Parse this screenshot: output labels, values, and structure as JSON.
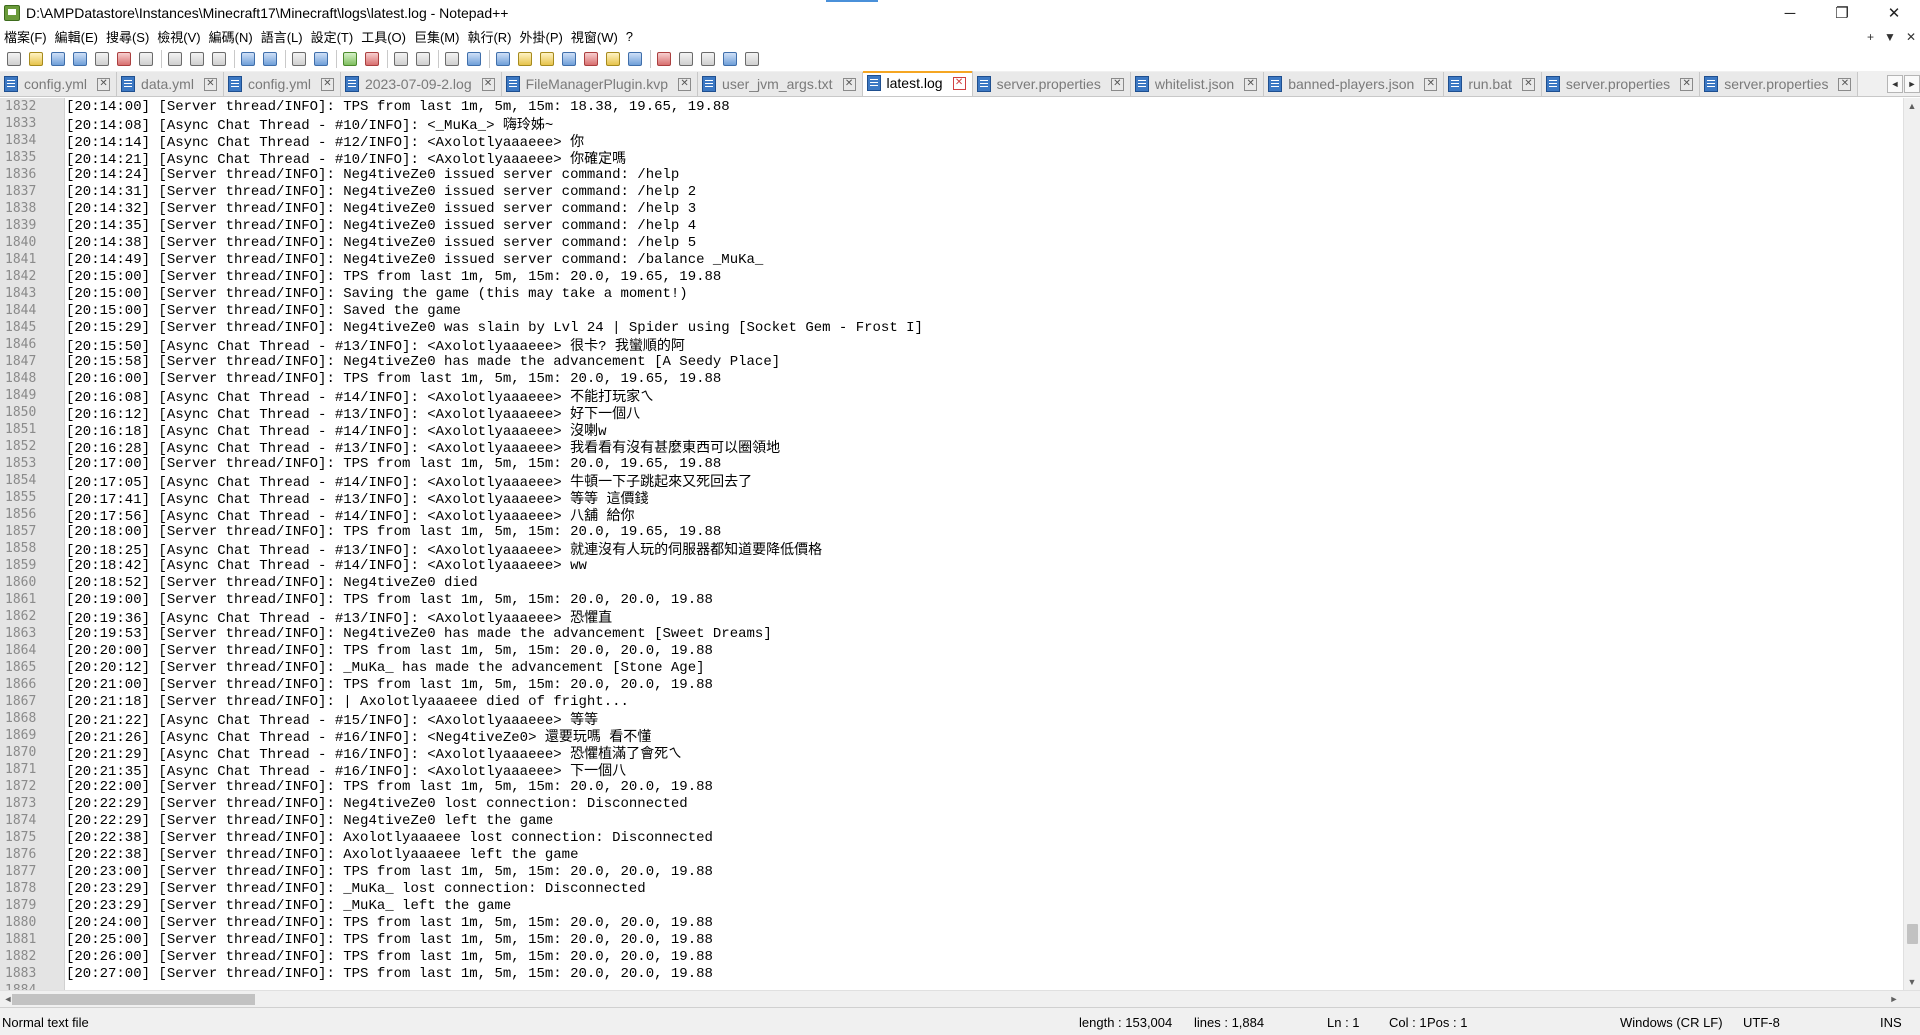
{
  "window": {
    "title": "D:\\AMPDatastore\\Instances\\Minecraft17\\Minecraft\\logs\\latest.log - Notepad++",
    "minimize": "─",
    "maximize": "❐",
    "close": "✕"
  },
  "menu": {
    "items": [
      "檔案(F)",
      "編輯(E)",
      "搜尋(S)",
      "檢視(V)",
      "編碼(N)",
      "語言(L)",
      "設定(T)",
      "工具(O)",
      "巨集(M)",
      "執行(R)",
      "外掛(P)",
      "視窗(W)",
      "?"
    ],
    "right": [
      "+",
      "▼",
      "✕"
    ]
  },
  "tabs": [
    {
      "label": "config.yml"
    },
    {
      "label": "data.yml"
    },
    {
      "label": "config.yml"
    },
    {
      "label": "2023-07-09-2.log"
    },
    {
      "label": "FileManagerPlugin.kvp"
    },
    {
      "label": "user_jvm_args.txt"
    },
    {
      "label": "latest.log",
      "active": true
    },
    {
      "label": "server.properties"
    },
    {
      "label": "whitelist.json"
    },
    {
      "label": "banned-players.json"
    },
    {
      "label": "run.bat"
    },
    {
      "label": "server.properties"
    },
    {
      "label": "server.properties"
    }
  ],
  "tab_nav": {
    "prev": "◄",
    "next": "►"
  },
  "lines": [
    {
      "n": "1832",
      "t": "[20:14:00] [Server thread/INFO]: TPS from last 1m, 5m, 15m: 18.38, 19.65, 19.88"
    },
    {
      "n": "1833",
      "t": "[20:14:08] [Async Chat Thread - #10/INFO]: <_MuKa_> 嗨玲姊~"
    },
    {
      "n": "1834",
      "t": "[20:14:14] [Async Chat Thread - #12/INFO]: <Axolotlyaaaeee> 你"
    },
    {
      "n": "1835",
      "t": "[20:14:21] [Async Chat Thread - #10/INFO]: <Axolotlyaaaeee> 你確定嗎"
    },
    {
      "n": "1836",
      "t": "[20:14:24] [Server thread/INFO]: Neg4tiveZe0 issued server command: /help"
    },
    {
      "n": "1837",
      "t": "[20:14:31] [Server thread/INFO]: Neg4tiveZe0 issued server command: /help 2"
    },
    {
      "n": "1838",
      "t": "[20:14:32] [Server thread/INFO]: Neg4tiveZe0 issued server command: /help 3"
    },
    {
      "n": "1839",
      "t": "[20:14:35] [Server thread/INFO]: Neg4tiveZe0 issued server command: /help 4"
    },
    {
      "n": "1840",
      "t": "[20:14:38] [Server thread/INFO]: Neg4tiveZe0 issued server command: /help 5"
    },
    {
      "n": "1841",
      "t": "[20:14:49] [Server thread/INFO]: Neg4tiveZe0 issued server command: /balance _MuKa_"
    },
    {
      "n": "1842",
      "t": "[20:15:00] [Server thread/INFO]: TPS from last 1m, 5m, 15m: 20.0, 19.65, 19.88"
    },
    {
      "n": "1843",
      "t": "[20:15:00] [Server thread/INFO]: Saving the game (this may take a moment!)"
    },
    {
      "n": "1844",
      "t": "[20:15:00] [Server thread/INFO]: Saved the game"
    },
    {
      "n": "1845",
      "t": "[20:15:29] [Server thread/INFO]: Neg4tiveZe0 was slain by Lvl 24 | Spider using [Socket Gem - Frost I]"
    },
    {
      "n": "1846",
      "t": "[20:15:50] [Async Chat Thread - #13/INFO]: <Axolotlyaaaeee> 很卡? 我蠻順的阿"
    },
    {
      "n": "1847",
      "t": "[20:15:58] [Server thread/INFO]: Neg4tiveZe0 has made the advancement [A Seedy Place]"
    },
    {
      "n": "1848",
      "t": "[20:16:00] [Server thread/INFO]: TPS from last 1m, 5m, 15m: 20.0, 19.65, 19.88"
    },
    {
      "n": "1849",
      "t": "[20:16:08] [Async Chat Thread - #14/INFO]: <Axolotlyaaaeee> 不能打玩家ㄟ"
    },
    {
      "n": "1850",
      "t": "[20:16:12] [Async Chat Thread - #13/INFO]: <Axolotlyaaaeee> 好下一個八"
    },
    {
      "n": "1851",
      "t": "[20:16:18] [Async Chat Thread - #14/INFO]: <Axolotlyaaaeee> 沒喇w"
    },
    {
      "n": "1852",
      "t": "[20:16:28] [Async Chat Thread - #13/INFO]: <Axolotlyaaaeee> 我看看有沒有甚麼東西可以圈領地"
    },
    {
      "n": "1853",
      "t": "[20:17:00] [Server thread/INFO]: TPS from last 1m, 5m, 15m: 20.0, 19.65, 19.88"
    },
    {
      "n": "1854",
      "t": "[20:17:05] [Async Chat Thread - #14/INFO]: <Axolotlyaaaeee> 牛頓一下子跳起來又死回去了"
    },
    {
      "n": "1855",
      "t": "[20:17:41] [Async Chat Thread - #13/INFO]: <Axolotlyaaaeee> 等等 這價錢"
    },
    {
      "n": "1856",
      "t": "[20:17:56] [Async Chat Thread - #14/INFO]: <Axolotlyaaaeee> 八舖 給你"
    },
    {
      "n": "1857",
      "t": "[20:18:00] [Server thread/INFO]: TPS from last 1m, 5m, 15m: 20.0, 19.65, 19.88"
    },
    {
      "n": "1858",
      "t": "[20:18:25] [Async Chat Thread - #13/INFO]: <Axolotlyaaaeee> 就連沒有人玩的伺服器都知道要降低價格"
    },
    {
      "n": "1859",
      "t": "[20:18:42] [Async Chat Thread - #14/INFO]: <Axolotlyaaaeee> ww"
    },
    {
      "n": "1860",
      "t": "[20:18:52] [Server thread/INFO]: Neg4tiveZe0 died"
    },
    {
      "n": "1861",
      "t": "[20:19:00] [Server thread/INFO]: TPS from last 1m, 5m, 15m: 20.0, 20.0, 19.88"
    },
    {
      "n": "1862",
      "t": "[20:19:36] [Async Chat Thread - #13/INFO]: <Axolotlyaaaeee> 恐懼直"
    },
    {
      "n": "1863",
      "t": "[20:19:53] [Server thread/INFO]: Neg4tiveZe0 has made the advancement [Sweet Dreams]"
    },
    {
      "n": "1864",
      "t": "[20:20:00] [Server thread/INFO]: TPS from last 1m, 5m, 15m: 20.0, 20.0, 19.88"
    },
    {
      "n": "1865",
      "t": "[20:20:12] [Server thread/INFO]: _MuKa_ has made the advancement [Stone Age]"
    },
    {
      "n": "1866",
      "t": "[20:21:00] [Server thread/INFO]: TPS from last 1m, 5m, 15m: 20.0, 20.0, 19.88"
    },
    {
      "n": "1867",
      "t": "[20:21:18] [Server thread/INFO]: | Axolotlyaaaeee died of fright..."
    },
    {
      "n": "1868",
      "t": "[20:21:22] [Async Chat Thread - #15/INFO]: <Axolotlyaaaeee> 等等"
    },
    {
      "n": "1869",
      "t": "[20:21:26] [Async Chat Thread - #16/INFO]: <Neg4tiveZe0> 還要玩嗎 看不懂"
    },
    {
      "n": "1870",
      "t": "[20:21:29] [Async Chat Thread - #16/INFO]: <Axolotlyaaaeee> 恐懼植滿了會死ㄟ"
    },
    {
      "n": "1871",
      "t": "[20:21:35] [Async Chat Thread - #16/INFO]: <Axolotlyaaaeee> 下一個八"
    },
    {
      "n": "1872",
      "t": "[20:22:00] [Server thread/INFO]: TPS from last 1m, 5m, 15m: 20.0, 20.0, 19.88"
    },
    {
      "n": "1873",
      "t": "[20:22:29] [Server thread/INFO]: Neg4tiveZe0 lost connection: Disconnected"
    },
    {
      "n": "1874",
      "t": "[20:22:29] [Server thread/INFO]: Neg4tiveZe0 left the game"
    },
    {
      "n": "1875",
      "t": "[20:22:38] [Server thread/INFO]: Axolotlyaaaeee lost connection: Disconnected"
    },
    {
      "n": "1876",
      "t": "[20:22:38] [Server thread/INFO]: Axolotlyaaaeee left the game"
    },
    {
      "n": "1877",
      "t": "[20:23:00] [Server thread/INFO]: TPS from last 1m, 5m, 15m: 20.0, 20.0, 19.88"
    },
    {
      "n": "1878",
      "t": "[20:23:29] [Server thread/INFO]: _MuKa_ lost connection: Disconnected"
    },
    {
      "n": "1879",
      "t": "[20:23:29] [Server thread/INFO]: _MuKa_ left the game"
    },
    {
      "n": "1880",
      "t": "[20:24:00] [Server thread/INFO]: TPS from last 1m, 5m, 15m: 20.0, 20.0, 19.88"
    },
    {
      "n": "1881",
      "t": "[20:25:00] [Server thread/INFO]: TPS from last 1m, 5m, 15m: 20.0, 20.0, 19.88"
    },
    {
      "n": "1882",
      "t": "[20:26:00] [Server thread/INFO]: TPS from last 1m, 5m, 15m: 20.0, 20.0, 19.88"
    },
    {
      "n": "1883",
      "t": "[20:27:00] [Server thread/INFO]: TPS from last 1m, 5m, 15m: 20.0, 20.0, 19.88"
    },
    {
      "n": "1884",
      "t": ""
    }
  ],
  "scroll": {
    "up": "▲",
    "down": "▼",
    "left": "◄",
    "right": "►"
  },
  "status": {
    "file_type": "Normal text file",
    "length": "length : 153,004",
    "lines": "lines : 1,884",
    "ln": "Ln : 1",
    "col": "Col : 1",
    "pos": "Pos : 1",
    "eol": "Windows (CR LF)",
    "encoding": "UTF-8",
    "mode": "INS"
  }
}
